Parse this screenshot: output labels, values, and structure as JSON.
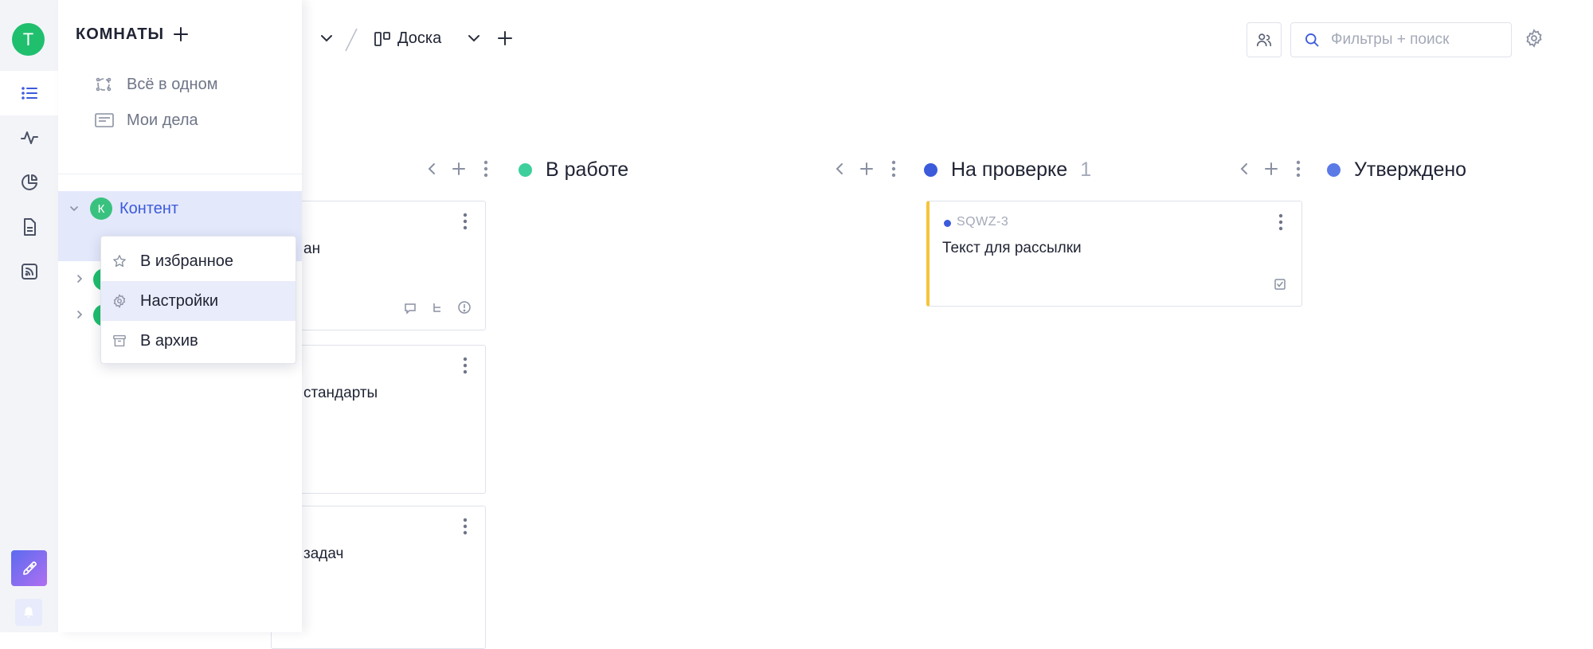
{
  "user": {
    "initial": "T"
  },
  "rail": {
    "active": "list"
  },
  "header": {
    "view_label": "Доска",
    "search_placeholder": "Фильтры + поиск"
  },
  "columns": [
    {
      "title": "В работе",
      "count": "",
      "color": "#3ecf9c"
    },
    {
      "title": "На проверке",
      "count": "1",
      "color": "#3b5bdb"
    },
    {
      "title": "Утверждено",
      "count": "",
      "color": "#5b7ae6"
    }
  ],
  "hidden_cards": [
    {
      "text": "ан"
    },
    {
      "text": "стандарты"
    },
    {
      "text": "задач"
    }
  ],
  "review_card": {
    "id": "SQWZ-3",
    "title": "Текст для рассылки",
    "accent": "#f5c33b"
  },
  "sidebar": {
    "title": "КОМНАТЫ",
    "links": [
      {
        "label": "Всё в одном"
      },
      {
        "label": "Мои дела"
      }
    ],
    "room": {
      "initial": "К",
      "name": "Контент"
    }
  },
  "context_menu": {
    "items": [
      {
        "label": "В избранное",
        "icon": "star-icon"
      },
      {
        "label": "Настройки",
        "icon": "gear-icon",
        "highlighted": true
      },
      {
        "label": "В архив",
        "icon": "archive-icon"
      }
    ]
  }
}
